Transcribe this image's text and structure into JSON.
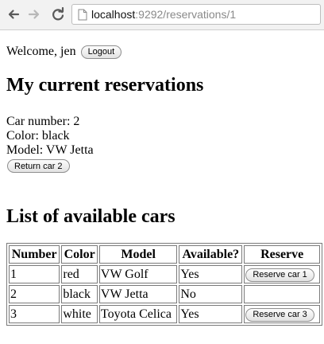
{
  "browser": {
    "url_host": "localhost",
    "url_rest": ":9292/reservations/1"
  },
  "header": {
    "welcome_text": "Welcome, jen",
    "logout_label": "Logout"
  },
  "current": {
    "heading": "My current reservations",
    "car_number": "Car number: 2",
    "color": "Color: black",
    "model": "Model: VW Jetta",
    "return_label": "Return car 2"
  },
  "available": {
    "heading": "List of available cars",
    "columns": [
      "Number",
      "Color",
      "Model",
      "Available?",
      "Reserve"
    ],
    "rows": [
      {
        "number": "1",
        "color": "red",
        "model": "VW Golf",
        "available": "Yes",
        "reserve_label": "Reserve car 1"
      },
      {
        "number": "2",
        "color": "black",
        "model": "VW Jetta",
        "available": "No",
        "reserve_label": ""
      },
      {
        "number": "3",
        "color": "white",
        "model": "Toyota Celica",
        "available": "Yes",
        "reserve_label": "Reserve car 3"
      }
    ]
  }
}
